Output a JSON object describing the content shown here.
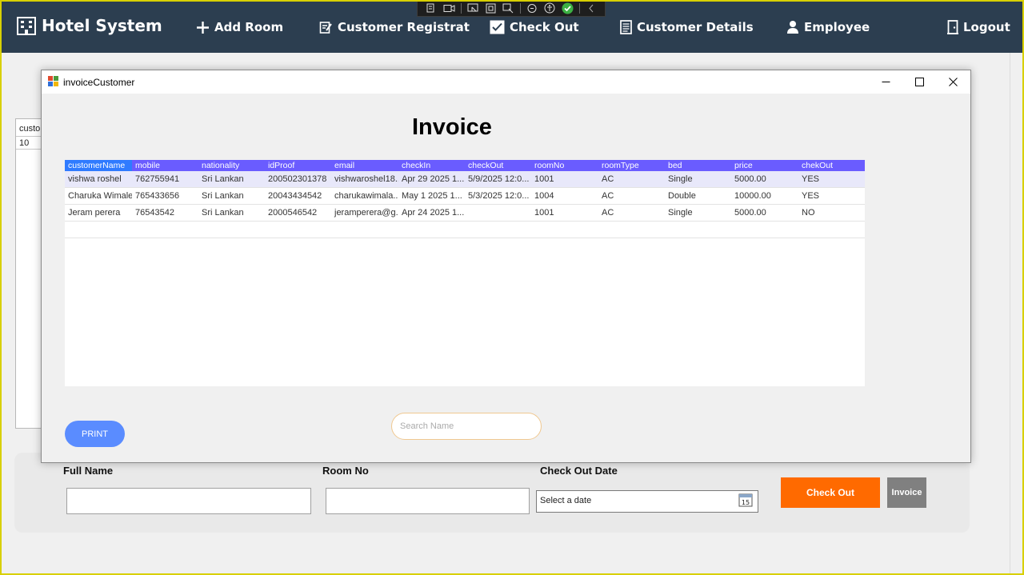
{
  "nav": {
    "brand": "Hotel System",
    "items": [
      {
        "label": "Add Room"
      },
      {
        "label": "Customer Registrat"
      },
      {
        "label": "Check Out"
      },
      {
        "label": "Customer Details"
      },
      {
        "label": "Employee"
      },
      {
        "label": "Logout"
      }
    ]
  },
  "background_form": {
    "grid_header": "custo",
    "grid_cell": "10",
    "labels": {
      "full_name": "Full Name",
      "room_no": "Room No",
      "check_out_date": "Check Out Date"
    },
    "date_placeholder": "Select a date",
    "calendar_day": "15",
    "checkout_button": "Check Out",
    "invoice_button": "Invoice"
  },
  "dialog": {
    "title": "invoiceCustomer",
    "heading": "Invoice",
    "columns": [
      "customerName",
      "mobile",
      "nationality",
      "idProof",
      "email",
      "checkIn",
      "checkOut",
      "roomNo",
      "roomType",
      "bed",
      "price",
      "chekOut"
    ],
    "rows": [
      [
        "vishwa roshel",
        "762755941",
        "Sri Lankan",
        "200502301378",
        "vishwaroshel18...",
        "Apr 29 2025 1...",
        "5/9/2025 12:0...",
        "1001",
        "AC",
        "Single",
        "5000.00",
        "YES"
      ],
      [
        "Charuka Wimale",
        "765433656",
        "Sri Lankan",
        "20043434542",
        "charukawimala...",
        "May  1 2025 1...",
        "5/3/2025 12:0...",
        "1004",
        "AC",
        "Double",
        "10000.00",
        "YES"
      ],
      [
        "Jeram perera",
        "76543542",
        "Sri Lankan",
        "2000546542",
        "jeramperera@g...",
        "Apr 24 2025 1...",
        "",
        "1001",
        "AC",
        "Single",
        "5000.00",
        "NO"
      ]
    ],
    "print_button": "PRINT",
    "search_placeholder": "Search Name"
  },
  "colors": {
    "nav_bg": "#2c3e50",
    "grid_header": "#6a5cff",
    "print_button": "#5a8cff",
    "checkout_button": "#ff6a00",
    "invoice_button": "#808080"
  }
}
